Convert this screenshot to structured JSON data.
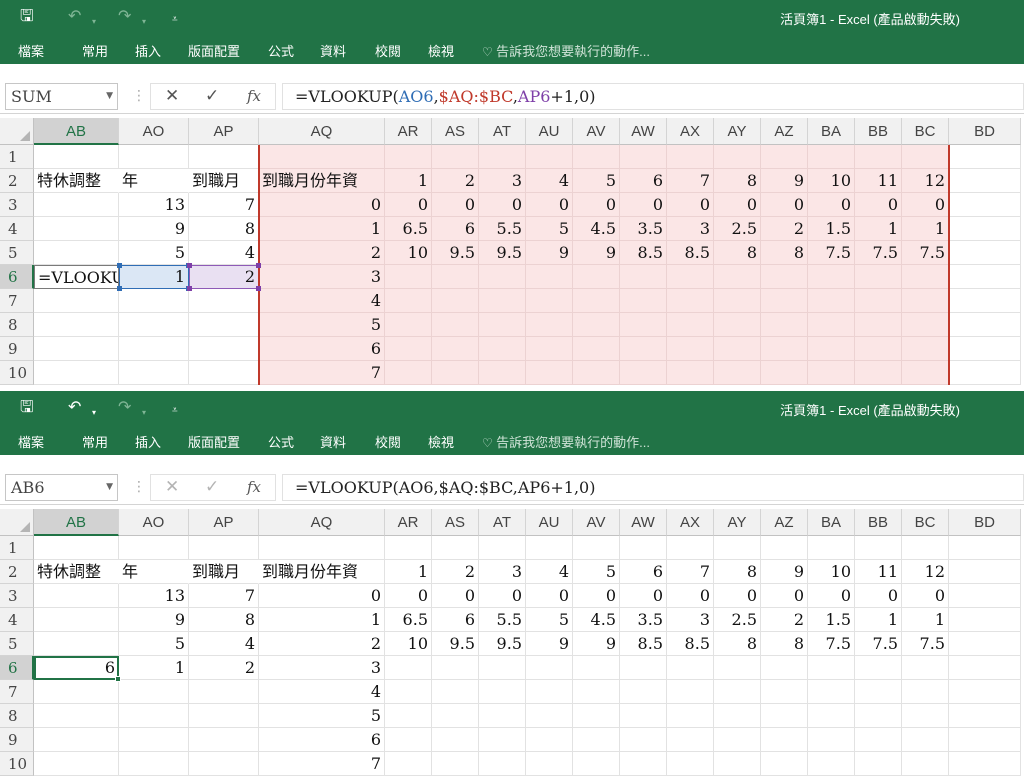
{
  "colors": {
    "excel_green": "#217346",
    "ref_blue": "#2f6db5",
    "ref_red": "#c0392b",
    "ref_purple": "#7e3fa8",
    "range_fill": "#fbe6e6"
  },
  "window": {
    "title": "活頁簿1 - Excel (產品啟動失敗)"
  },
  "quick_access": {
    "save_icon": "save-icon",
    "undo_icon": "undo-icon",
    "redo_icon": "redo-icon",
    "customize_icon": "customize-icon"
  },
  "ribbon": {
    "tabs": [
      "檔案",
      "常用",
      "插入",
      "版面配置",
      "公式",
      "資料",
      "校閱",
      "檢視"
    ],
    "tell_me": "告訴我您想要執行的動作..."
  },
  "columns": [
    "AB",
    "AO",
    "AP",
    "AQ",
    "AR",
    "AS",
    "AT",
    "AU",
    "AV",
    "AW",
    "AX",
    "AY",
    "AZ",
    "BA",
    "BB",
    "BC",
    "BD"
  ],
  "rows": [
    "1",
    "2",
    "3",
    "4",
    "5",
    "6",
    "7",
    "8",
    "9",
    "10"
  ],
  "cells": {
    "2": {
      "AB": "特休調整",
      "AO": "年",
      "AP": "到職月",
      "AQ": "到職月份年資",
      "AR": "1",
      "AS": "2",
      "AT": "3",
      "AU": "4",
      "AV": "5",
      "AW": "6",
      "AX": "7",
      "AY": "8",
      "AZ": "9",
      "BA": "10",
      "BB": "11",
      "BC": "12"
    },
    "3": {
      "AO": "13",
      "AP": "7",
      "AQ": "0",
      "AR": "0",
      "AS": "0",
      "AT": "0",
      "AU": "0",
      "AV": "0",
      "AW": "0",
      "AX": "0",
      "AY": "0",
      "AZ": "0",
      "BA": "0",
      "BB": "0",
      "BC": "0"
    },
    "4": {
      "AO": "9",
      "AP": "8",
      "AQ": "1",
      "AR": "6.5",
      "AS": "6",
      "AT": "5.5",
      "AU": "5",
      "AV": "4.5",
      "AW": "3.5",
      "AX": "3",
      "AY": "2.5",
      "AZ": "2",
      "BA": "1.5",
      "BB": "1",
      "BC": "1"
    },
    "5": {
      "AO": "5",
      "AP": "4",
      "AQ": "2",
      "AR": "10",
      "AS": "9.5",
      "AT": "9.5",
      "AU": "9",
      "AV": "9",
      "AW": "8.5",
      "AX": "8.5",
      "AY": "8",
      "AZ": "8",
      "BA": "7.5",
      "BB": "7.5",
      "BC": "7.5"
    },
    "6": {
      "AO": "1",
      "AP": "2",
      "AQ": "3"
    },
    "7": {
      "AQ": "4"
    },
    "8": {
      "AQ": "5"
    },
    "9": {
      "AQ": "6"
    },
    "10": {
      "AQ": "7"
    }
  },
  "top_pane": {
    "name_box": "SUM",
    "formula_parts": [
      "=VLOOKUP(",
      "AO6",
      ",",
      "$AQ:$BC",
      ",",
      "AP6",
      "+1,0)"
    ],
    "editing_cell_text": "=VLOOKU"
  },
  "bottom_pane": {
    "name_box": "AB6",
    "formula": "=VLOOKUP(AO6,$AQ:$BC,AP6+1,0)",
    "result_value": "6"
  }
}
